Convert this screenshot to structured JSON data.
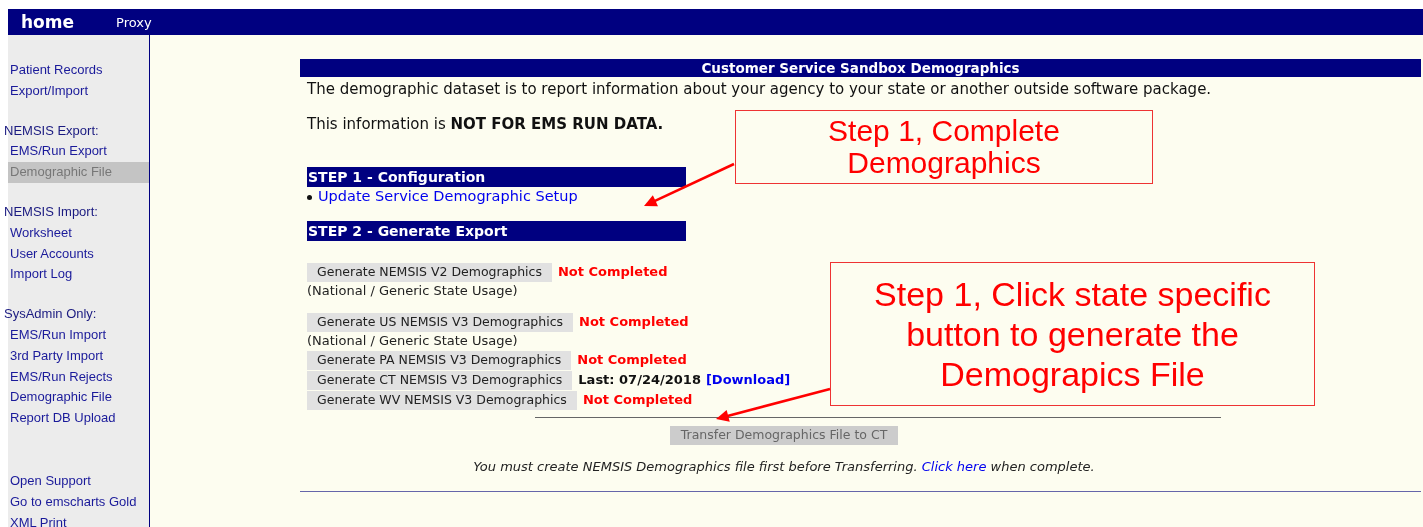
{
  "topbar": {
    "home": "home",
    "proxy": "Proxy"
  },
  "sidebar": {
    "groups": [
      {
        "items": [
          {
            "label": "Patient Records",
            "selected": false
          },
          {
            "label": "Export/Import",
            "selected": false
          }
        ]
      },
      {
        "heading": "NEMSIS Export:",
        "items": [
          {
            "label": "EMS/Run Export",
            "selected": false
          },
          {
            "label": "Demographic File",
            "selected": true
          }
        ]
      },
      {
        "heading": "NEMSIS Import:",
        "items": [
          {
            "label": "Worksheet",
            "selected": false
          },
          {
            "label": "User Accounts",
            "selected": false
          },
          {
            "label": "Import Log",
            "selected": false
          }
        ]
      },
      {
        "heading": "SysAdmin Only:",
        "items": [
          {
            "label": "EMS/Run Import",
            "selected": false
          },
          {
            "label": "3rd Party Import",
            "selected": false
          },
          {
            "label": "EMS/Run Rejects",
            "selected": false
          },
          {
            "label": "Demographic File",
            "selected": false
          },
          {
            "label": "Report DB Upload",
            "selected": false
          }
        ]
      },
      {
        "items": [
          {
            "label": "Open Support",
            "selected": false
          },
          {
            "label": "Go to emscharts Gold",
            "selected": false
          },
          {
            "label": "XML Print",
            "selected": false
          }
        ]
      }
    ]
  },
  "page_title": "Customer Service Sandbox Demographics",
  "intro": [
    "The demographic dataset is to report information about your agency to your state or another outside software package.",
    "This information is **NOT FOR EMS RUN DATA.**"
  ],
  "steps": [
    {
      "title": "STEP 1 - Configuration",
      "links": [
        "Update Service Demographic Setup"
      ]
    },
    {
      "title": "STEP 2 - Generate Export"
    }
  ],
  "export_groups": [
    [
      {
        "button": "Generate NEMSIS V2 Demographics",
        "status": {
          "kind": "not_completed",
          "text": "Not Completed"
        },
        "note": "(National / Generic State Usage)"
      }
    ],
    [
      {
        "button": "Generate US NEMSIS V3 Demographics",
        "status": {
          "kind": "not_completed",
          "text": "Not Completed"
        },
        "note": "(National / Generic State Usage)"
      },
      {
        "button": "Generate PA NEMSIS V3 Demographics",
        "status": {
          "kind": "not_completed",
          "text": "Not Completed"
        }
      },
      {
        "button": "Generate CT NEMSIS V3 Demographics",
        "status": {
          "kind": "last",
          "text": "Last: 07/24/2018",
          "link": "[Download]"
        }
      },
      {
        "button": "Generate WV NEMSIS V3 Demographics",
        "status": {
          "kind": "not_completed",
          "text": "Not Completed"
        }
      }
    ]
  ],
  "transfer": {
    "button": "Transfer Demographics File to CT",
    "disabled": true
  },
  "transfer_note": {
    "text": "You must create NEMSIS Demographics file first before Transferring.",
    "link": "Click here",
    "after": "when complete."
  },
  "callouts": [
    {
      "text": "Step 1, Complete Demographics"
    },
    {
      "text": "Step 1, Click state specific button to generate the Demograpics File"
    }
  ]
}
